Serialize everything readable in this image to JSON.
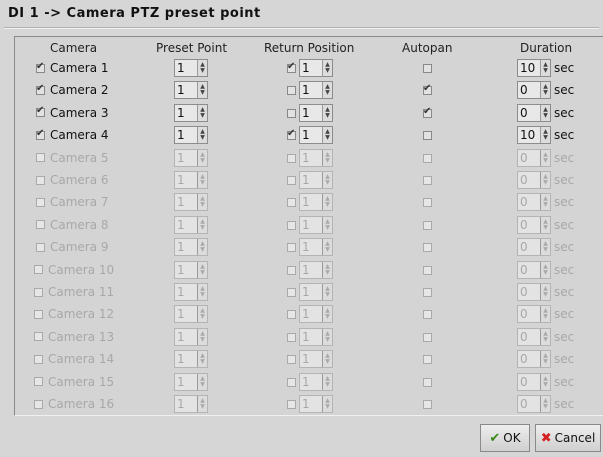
{
  "dialog": {
    "title": "DI 1 -> Camera PTZ preset point"
  },
  "columns": {
    "camera": "Camera",
    "preset": "Preset Point",
    "return_position": "Return Position",
    "autopan": "Autopan",
    "duration": "Duration"
  },
  "unit": "sec",
  "rows": [
    {
      "name": "Camera 1",
      "enabled": true,
      "preset": "1",
      "return_checked": true,
      "return_value": "1",
      "autopan": false,
      "duration": "10"
    },
    {
      "name": "Camera 2",
      "enabled": true,
      "preset": "1",
      "return_checked": false,
      "return_value": "1",
      "autopan": true,
      "duration": "0"
    },
    {
      "name": "Camera 3",
      "enabled": true,
      "preset": "1",
      "return_checked": false,
      "return_value": "1",
      "autopan": true,
      "duration": "0"
    },
    {
      "name": "Camera 4",
      "enabled": true,
      "preset": "1",
      "return_checked": true,
      "return_value": "1",
      "autopan": false,
      "duration": "10"
    },
    {
      "name": "Camera 5",
      "enabled": false,
      "preset": "1",
      "return_checked": false,
      "return_value": "1",
      "autopan": false,
      "duration": "0"
    },
    {
      "name": "Camera 6",
      "enabled": false,
      "preset": "1",
      "return_checked": false,
      "return_value": "1",
      "autopan": false,
      "duration": "0"
    },
    {
      "name": "Camera 7",
      "enabled": false,
      "preset": "1",
      "return_checked": false,
      "return_value": "1",
      "autopan": false,
      "duration": "0"
    },
    {
      "name": "Camera 8",
      "enabled": false,
      "preset": "1",
      "return_checked": false,
      "return_value": "1",
      "autopan": false,
      "duration": "0"
    },
    {
      "name": "Camera 9",
      "enabled": false,
      "preset": "1",
      "return_checked": false,
      "return_value": "1",
      "autopan": false,
      "duration": "0"
    },
    {
      "name": "Camera 10",
      "enabled": false,
      "preset": "1",
      "return_checked": false,
      "return_value": "1",
      "autopan": false,
      "duration": "0"
    },
    {
      "name": "Camera 11",
      "enabled": false,
      "preset": "1",
      "return_checked": false,
      "return_value": "1",
      "autopan": false,
      "duration": "0"
    },
    {
      "name": "Camera 12",
      "enabled": false,
      "preset": "1",
      "return_checked": false,
      "return_value": "1",
      "autopan": false,
      "duration": "0"
    },
    {
      "name": "Camera 13",
      "enabled": false,
      "preset": "1",
      "return_checked": false,
      "return_value": "1",
      "autopan": false,
      "duration": "0"
    },
    {
      "name": "Camera 14",
      "enabled": false,
      "preset": "1",
      "return_checked": false,
      "return_value": "1",
      "autopan": false,
      "duration": "0"
    },
    {
      "name": "Camera 15",
      "enabled": false,
      "preset": "1",
      "return_checked": false,
      "return_value": "1",
      "autopan": false,
      "duration": "0"
    },
    {
      "name": "Camera 16",
      "enabled": false,
      "preset": "1",
      "return_checked": false,
      "return_value": "1",
      "autopan": false,
      "duration": "0"
    }
  ],
  "buttons": {
    "ok_label": "OK",
    "ok_icon": "check-icon",
    "cancel_label": "Cancel",
    "cancel_icon": "x-icon",
    "cancel_icon_color": "#d42020",
    "ok_icon_color": "#3a8a1a"
  }
}
